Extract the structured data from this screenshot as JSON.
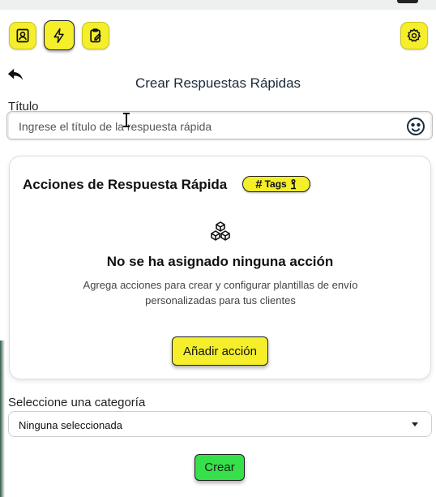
{
  "toolbar": {
    "contacts_icon": "contact-card-icon",
    "quick_replies_icon": "lightning-icon",
    "templates_icon": "clipboard-edit-icon",
    "settings_icon": "gear-icon",
    "accent_color": "#f4ef2a"
  },
  "page": {
    "back_icon": "reply-arrow-icon",
    "title": "Crear Respuestas Rápidas"
  },
  "title_field": {
    "label": "Título",
    "value": "",
    "placeholder": "Ingrese el título de la respuesta rápida",
    "emoji_icon": "smiley-icon"
  },
  "actions_card": {
    "title": "Acciones de Respuesta Rápida",
    "tags_label": "Tags",
    "tags_hash": "#",
    "empty_icon": "cubes-icon",
    "empty_title": "No se ha asignado ninguna acción",
    "empty_desc": "Agrega acciones para crear y configurar plantillas de envío personalizadas para tus clientes",
    "add_label": "Añadir acción"
  },
  "category": {
    "label": "Seleccione una categoría",
    "selected": "Ninguna seleccionada"
  },
  "submit": {
    "label": "Crear",
    "color": "#35e04a"
  }
}
